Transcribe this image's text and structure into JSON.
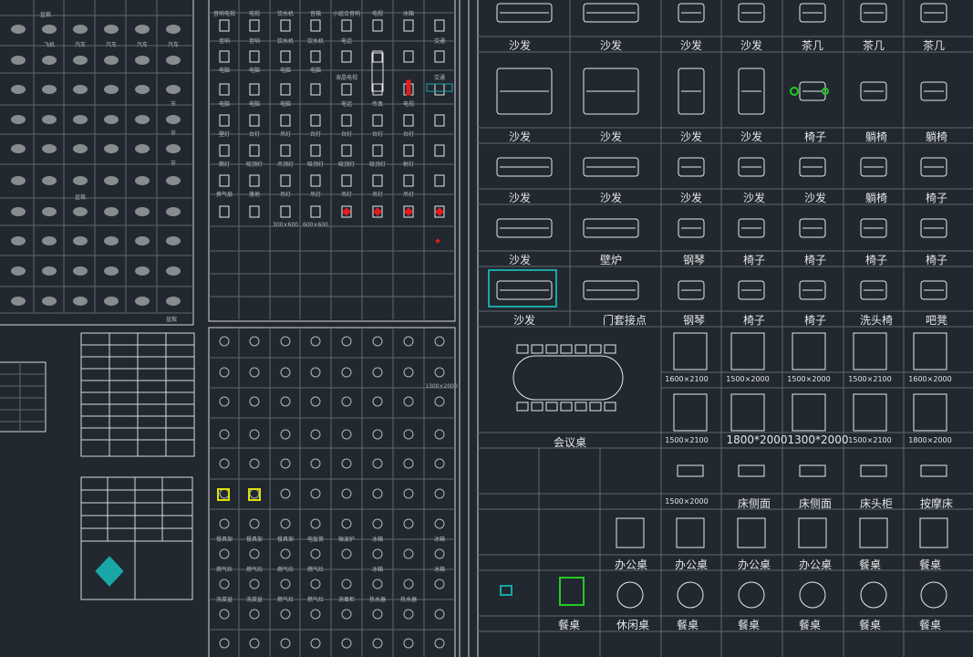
{
  "colors": {
    "background": "#212830",
    "frame": "#d9d9d9",
    "grid": "#5e6770",
    "symbol": "#e8e8e8",
    "symbol_gray": "#b6b6b6",
    "accent_cyan": "#1aa6a6",
    "accent_red": "#e81c1c",
    "accent_green": "#22cc22",
    "accent_yellow": "#e0e000"
  },
  "left_panel": {
    "row_labels": [
      "飞机",
      "汽车",
      "汽车",
      "汽车",
      "汽车"
    ],
    "small_labels": [
      "盆栽",
      "盆栽",
      "节",
      "节",
      "节",
      "盆栽"
    ],
    "tree_label": "盆栽"
  },
  "appliance_panel": {
    "header_labels": [
      "音响电视",
      "电视",
      "饮水机",
      "音箱",
      "小组合音响",
      "电视",
      "冰箱"
    ],
    "row1": [
      "音响",
      "音响",
      "饮水机",
      "饮水机",
      "电话",
      "交通"
    ],
    "row2": [
      "电脑",
      "电脑",
      "电脑",
      "电脑",
      "液晶电视",
      "交通"
    ],
    "row3": [
      "电脑",
      "电脑",
      "电脑",
      "电话",
      "传真",
      "电视"
    ],
    "row4": [
      "壁灯",
      "台灯",
      "吊灯",
      "台灯",
      "台灯",
      "台灯",
      "台灯"
    ],
    "row5": [
      "筒灯",
      "吸顶灯",
      "吊顶灯",
      "吸顶灯",
      "吸顶灯",
      "吸顶灯",
      "射灯"
    ],
    "row6": [
      "换气扇",
      "落地",
      "吊灯",
      "吊灯",
      "吊灯",
      "吊灯",
      "吊灯"
    ],
    "dim_labels": [
      "300×600",
      "600×600"
    ]
  },
  "bath_panel": {
    "dim_label": "1300×2000",
    "row_a": [
      "餐具架",
      "餐具架",
      "餐具架",
      "电饭煲",
      "微波炉",
      "冰箱",
      "冰箱"
    ],
    "row_b": [
      "燃气灶",
      "燃气灶",
      "燃气灶",
      "燃气灶",
      "冰箱",
      "冰箱"
    ],
    "row_c": [
      "洗菜盆",
      "洗菜盆",
      "燃气灶",
      "燃气灶",
      "消毒柜",
      "热水器",
      "热水器"
    ]
  },
  "furniture_panel": {
    "row1": [
      "沙发",
      "沙发",
      "沙发",
      "沙发",
      "茶几",
      "茶几",
      "茶几"
    ],
    "row2": [
      "沙发",
      "沙发",
      "沙发",
      "沙发",
      "椅子",
      "躺椅",
      "躺椅"
    ],
    "row3": [
      "沙发",
      "沙发",
      "沙发",
      "沙发",
      "沙发",
      "躺椅",
      "椅子"
    ],
    "row4": [
      "沙发",
      "壁炉",
      "钢琴",
      "椅子",
      "椅子",
      "椅子",
      "椅子"
    ],
    "row5": [
      "沙发",
      "门套接点",
      "钢琴",
      "椅子",
      "椅子",
      "洗头椅",
      "吧凳"
    ],
    "bed_row1_dims": [
      "1600×2100",
      "1500×2000",
      "1500×2000",
      "1500×2100",
      "1600×2000"
    ],
    "meeting_table": "会议桌",
    "bed_row2_dims": [
      "1500×2100",
      "1800*2000",
      "1300*2000",
      "1500×2100",
      "1800×2000"
    ],
    "row8": [
      "1500×2000",
      "床侧面",
      "床侧面",
      "床头柜",
      "按摩床"
    ],
    "row9": [
      "办公桌",
      "办公桌",
      "办公桌",
      "办公桌",
      "餐桌",
      "餐桌"
    ],
    "row10": [
      "餐桌",
      "休闲桌",
      "餐桌",
      "餐桌",
      "餐桌",
      "餐桌",
      "餐桌"
    ]
  }
}
